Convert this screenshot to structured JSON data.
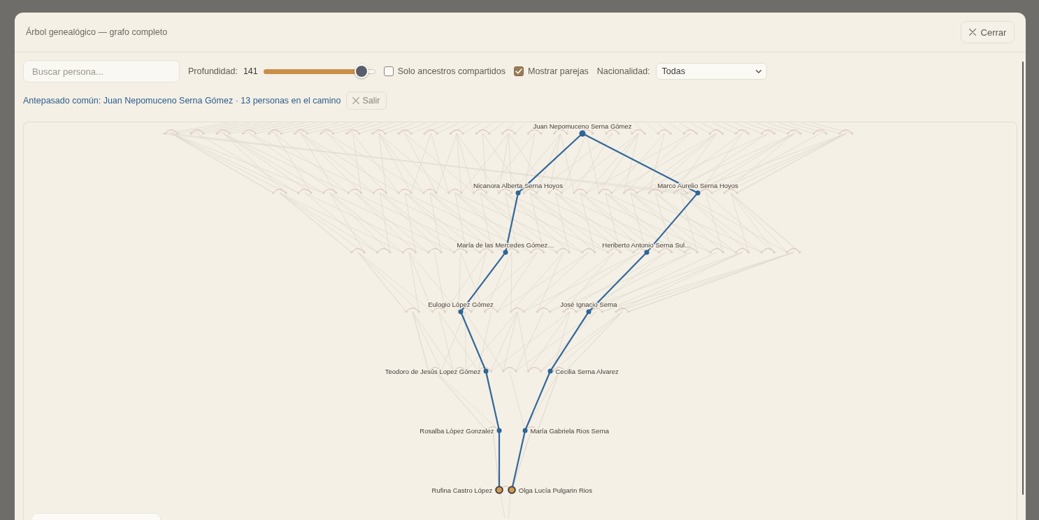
{
  "window": {
    "title": "Árbol genealógico — grafo completo",
    "close_button": "Cerrar"
  },
  "toolbar": {
    "search": {
      "placeholder": "Buscar persona..."
    },
    "depth": {
      "label": "Profundidad:",
      "value": "141",
      "level": 0.875
    },
    "filters": [
      {
        "label": "Solo ancestros compartidos",
        "checked": false
      },
      {
        "label": "Mostrar parejas",
        "checked": true
      }
    ],
    "nationality": {
      "label": "Nacionalidad:",
      "value": "Todas"
    }
  },
  "path_banner": {
    "text": "Antepasado común: Juan Nepomuceno Serna Gómez · 13 personas en el camino",
    "exit_button": "Salir"
  },
  "graph": {
    "common_ancestor": {
      "name": "Juan Nepomuceno Serna Gómez",
      "selected": false,
      "children": [
        {
          "name": "Nicanora Alberta Serna Hoyos",
          "selected": false,
          "children": [
            {
              "name": "María de las Mercedes Gómez…",
              "selected": false,
              "children": [
                {
                  "name": "Eulogio López Gómez",
                  "selected": false,
                  "children": [
                    {
                      "name": "Teodoro de Jesús Lopez Gómez",
                      "selected": false,
                      "children": [
                        {
                          "name": "Rosalba López Gonzalez",
                          "selected": false,
                          "children": [
                            {
                              "name": "Rufina Castro López",
                              "selected": true
                            }
                          ]
                        }
                      ]
                    }
                  ]
                }
              ]
            }
          ]
        },
        {
          "name": "Marco Aurelio Serna Hoyos",
          "selected": false,
          "children": [
            {
              "name": "Heriberto Antonio Serna Sul…",
              "selected": false,
              "children": [
                {
                  "name": "José Ignacio Serna",
                  "selected": false,
                  "children": [
                    {
                      "name": "Cecilia Serna Alvarez",
                      "selected": false,
                      "children": [
                        {
                          "name": "María Gabriela Rios Serna",
                          "selected": false,
                          "children": [
                            {
                              "name": "Olga Lucía Pulgarin Rios",
                              "selected": true
                            }
                          ]
                        }
                      ]
                    }
                  ]
                }
              ]
            }
          ]
        }
      ]
    }
  }
}
